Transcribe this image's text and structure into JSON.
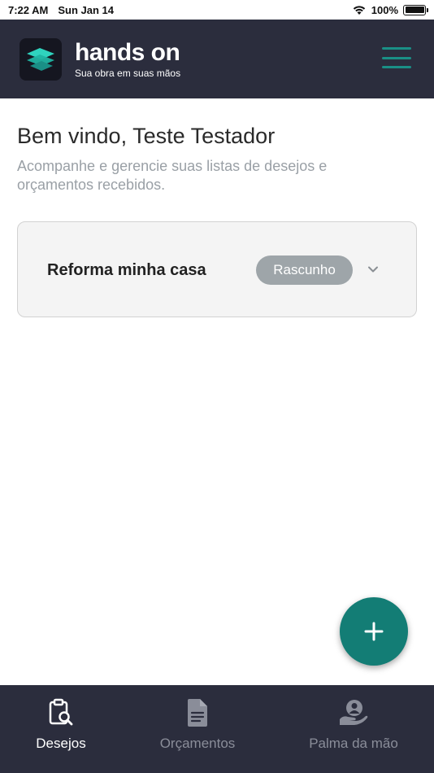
{
  "status_bar": {
    "time": "7:22 AM",
    "date": "Sun Jan 14",
    "battery": "100%"
  },
  "header": {
    "brand_name": "hands on",
    "tagline": "Sua obra em suas mãos",
    "logo_icon": "hands-on-logo-icon",
    "menu_icon": "hamburger-menu-icon"
  },
  "main": {
    "welcome": "Bem vindo, Teste Testador",
    "subtitle": "Acompanhe e gerencie suas listas de desejos e orçamentos recebidos.",
    "cards": [
      {
        "title": "Reforma minha casa",
        "status": "Rascunho"
      }
    ]
  },
  "fab": {
    "icon": "plus-icon"
  },
  "bottom_nav": {
    "items": [
      {
        "label": "Desejos",
        "icon": "clipboard-search-icon",
        "active": true
      },
      {
        "label": "Orçamentos",
        "icon": "document-icon",
        "active": false
      },
      {
        "label": "Palma da mão",
        "icon": "hand-person-icon",
        "active": false
      }
    ]
  },
  "colors": {
    "header_bg": "#2b2d3d",
    "accent": "#137d75",
    "badge_bg": "#9ea5a9"
  }
}
